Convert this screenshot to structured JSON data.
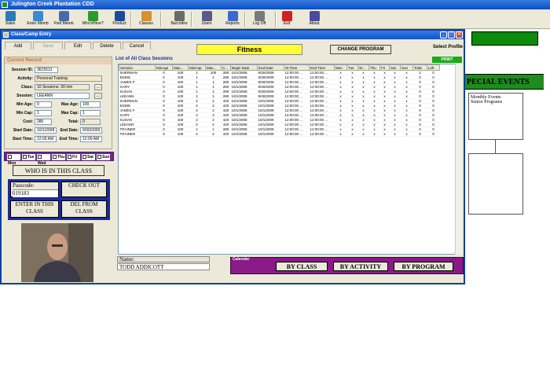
{
  "app": {
    "title": "Julington Creek Plantation CDD"
  },
  "toolbar": {
    "items": [
      {
        "label": "Sales",
        "icon": "sales-icon",
        "color": "#2a7ab8"
      },
      {
        "label": "Enter Memb",
        "icon": "enter-member-icon",
        "color": "#3a8ad0"
      },
      {
        "label": "Find Memb",
        "icon": "find-member-icon",
        "color": "#4a6ab0"
      },
      {
        "label": "Who'sHere?",
        "icon": "whos-here-icon",
        "color": "#2a9a2a"
      },
      {
        "label": "Product",
        "icon": "product-icon",
        "color": "#1a4a9a"
      },
      {
        "label": "Classes",
        "icon": "classes-icon",
        "color": "#d89030"
      },
      {
        "label": "Barcodes",
        "icon": "barcodes-icon",
        "color": "#6a6a6a"
      },
      {
        "label": "Users",
        "icon": "users-icon",
        "color": "#5a5a8a"
      },
      {
        "label": "Reports",
        "icon": "reports-icon",
        "color": "#3a6ad0"
      },
      {
        "label": "Log Off",
        "icon": "log-off-icon",
        "color": "#7a7a7a"
      },
      {
        "label": "Exit",
        "icon": "exit-icon",
        "color": "#d02020"
      },
      {
        "label": "About",
        "icon": "about-icon",
        "color": "#4a4aa0"
      }
    ]
  },
  "right_panel": {
    "events_heading": "PECIAL EVENTS",
    "box_lines": [
      "Monthly Events",
      "Senior Programs"
    ]
  },
  "window": {
    "title": "Class/Camp Entry",
    "tabs": [
      "Add",
      "Save",
      "Edit",
      "Delete",
      "Cancel"
    ],
    "program": "Fitness",
    "change_program": "CHANGE PROGRAM",
    "select_profile": "Select Profile"
  },
  "current_record": {
    "title": "Current Record",
    "session_id_label": "Session ID:",
    "session_id": "3615513",
    "activity_label": "Activity:",
    "activity": "Personal Training",
    "class_label": "Class:",
    "class": "10 Sessions- 30 min",
    "session_label": "Session:",
    "session": "LEEANN",
    "min_age_label": "Min Age:",
    "min_age": "0",
    "max_age_label": "Max Age:",
    "max_age": "100",
    "min_cap_label": "Min Cap:",
    "min_cap": "1",
    "max_cap_label": "Max Cap:",
    "max_cap": "1",
    "cost_label": "Cost:",
    "cost": "280",
    "total_label": "Total:",
    "total": "0",
    "start_date_label": "Start Date:",
    "start_date": "10/1/2008",
    "end_date_label": "End Date:",
    "end_date": "9/30/2009",
    "start_time_label": "Start Time:",
    "start_time": "12:00 AM",
    "end_time_label": "End Time:",
    "end_time": "12:00 AM"
  },
  "days": [
    "Mon",
    "Tue",
    "Wed",
    "Thu",
    "Fri",
    "Sat",
    "Sun"
  ],
  "who_button": "WHO IS IN THIS CLASS",
  "checkin": {
    "passcode_label": "Passcode:",
    "passcode": "019183",
    "check_out": "CHECK OUT",
    "enter_in_class": "ENTER IN THIS CLASS",
    "del_from_class": "DEL FROM CLASS"
  },
  "list": {
    "title": "List of All Class Sessions",
    "print": "PRINT",
    "columns": [
      "Session",
      "MinAge",
      "Max...",
      "MinCap",
      "Max...",
      "C...",
      "Begin Date",
      "End Date",
      "St Time",
      "End Time",
      "Mon",
      "Tue",
      "W...",
      "Thu",
      "Fri",
      "Sat",
      "Sun",
      "Total",
      "Left"
    ],
    "rows": [
      [
        "SHERMAN",
        "0",
        "100",
        "1",
        "100",
        "280",
        "10/1/2008",
        "9/30/2009",
        "12:00:00 ...",
        "12:00:00 ...",
        "x",
        "x",
        "x",
        "x",
        "x",
        "x",
        "x",
        "2",
        "0"
      ],
      [
        "EDDIE",
        "0",
        "100",
        "1",
        "1",
        "280",
        "10/1/2008",
        "9/30/2009",
        "12:00:00 ...",
        "12:00:00 ...",
        "x",
        "x",
        "x",
        "x",
        "x",
        "x",
        "x",
        "0",
        "0"
      ],
      [
        "JAMES F.",
        "0",
        "100",
        "1",
        "1",
        "280",
        "10/1/2008",
        "9/30/2009",
        "12:00:00 ...",
        "12:00:00 ...",
        "x",
        "x",
        "x",
        "x",
        "x",
        "x",
        "x",
        "0",
        "0"
      ],
      [
        "GARY",
        "0",
        "100",
        "1",
        "1",
        "280",
        "10/1/2008",
        "9/30/2009",
        "12:00:00 ...",
        "12:00:00 ...",
        "x",
        "x",
        "x",
        "x",
        "x",
        "x",
        "x",
        "0",
        "0"
      ],
      [
        "SUSAN",
        "0",
        "100",
        "1",
        "1",
        "280",
        "10/1/2008",
        "9/30/2009",
        "12:00:00 ...",
        "12:00:00 ...",
        "x",
        "x",
        "x",
        "x",
        "x",
        "x",
        "x",
        "0",
        "0"
      ],
      [
        "LEEANN",
        "0",
        "100",
        "1",
        "1",
        "280",
        "10/1/2008",
        "9/30/2009",
        "12:00:00 ...",
        "12:00:00 ...",
        "x",
        "x",
        "x",
        "x",
        "x",
        "x",
        "x",
        "0",
        "0"
      ],
      [
        "SHERMAN",
        "0",
        "100",
        "2",
        "2",
        "420",
        "10/1/2008",
        "10/1/2009",
        "12:00:00 ...",
        "12:00:00 ...",
        "x",
        "x",
        "x",
        "x",
        "x",
        "x",
        "x",
        "0",
        "0"
      ],
      [
        "EDDIE",
        "0",
        "100",
        "2",
        "2",
        "420",
        "10/1/2008",
        "10/1/2009",
        "12:00:00 ...",
        "12:00:00 ...",
        "x",
        "x",
        "x",
        "x",
        "x",
        "x",
        "x",
        "0",
        "0"
      ],
      [
        "JAMES F.",
        "0",
        "100",
        "2",
        "2",
        "420",
        "10/1/2008",
        "10/1/2009",
        "12:00:00 ...",
        "12:00:00 ...",
        "x",
        "x",
        "x",
        "x",
        "x",
        "x",
        "x",
        "0",
        "0"
      ],
      [
        "GARY",
        "0",
        "100",
        "2",
        "2",
        "420",
        "10/1/2008",
        "10/1/2009",
        "12:00:00 ...",
        "12:00:00 ...",
        "x",
        "x",
        "x",
        "x",
        "x",
        "x",
        "x",
        "0",
        "0"
      ],
      [
        "SUSAN",
        "0",
        "100",
        "2",
        "2",
        "420",
        "10/1/2008",
        "10/1/2009",
        "12:00:00 ...",
        "12:00:00 ...",
        "x",
        "x",
        "x",
        "x",
        "x",
        "x",
        "x",
        "0",
        "0"
      ],
      [
        "LEEANN",
        "0",
        "100",
        "2",
        "2",
        "420",
        "10/1/2008",
        "10/1/2009",
        "12:00:00 ...",
        "12:00:00 ...",
        "x",
        "x",
        "x",
        "x",
        "x",
        "x",
        "x",
        "0",
        "0"
      ],
      [
        "TRAINER",
        "0",
        "100",
        "1",
        "1",
        "280",
        "10/1/2008",
        "10/1/2009",
        "12:00:00 ...",
        "12:00:00 ...",
        "x",
        "x",
        "x",
        "x",
        "x",
        "x",
        "x",
        "0",
        "0"
      ],
      [
        "TRAINER",
        "0",
        "100",
        "2",
        "2",
        "420",
        "10/1/2008",
        "10/1/2009",
        "12:00:00 ...",
        "12:00:00 ...",
        "x",
        "x",
        "x",
        "x",
        "x",
        "x",
        "x",
        "0",
        "0"
      ]
    ]
  },
  "name_box": {
    "label": "Name:",
    "value": "TODD ADDICOTT"
  },
  "calendar": {
    "title": "Calendar",
    "buttons": [
      "BY CLASS",
      "BY ACTIVITY",
      "BY PROGRAM"
    ]
  }
}
